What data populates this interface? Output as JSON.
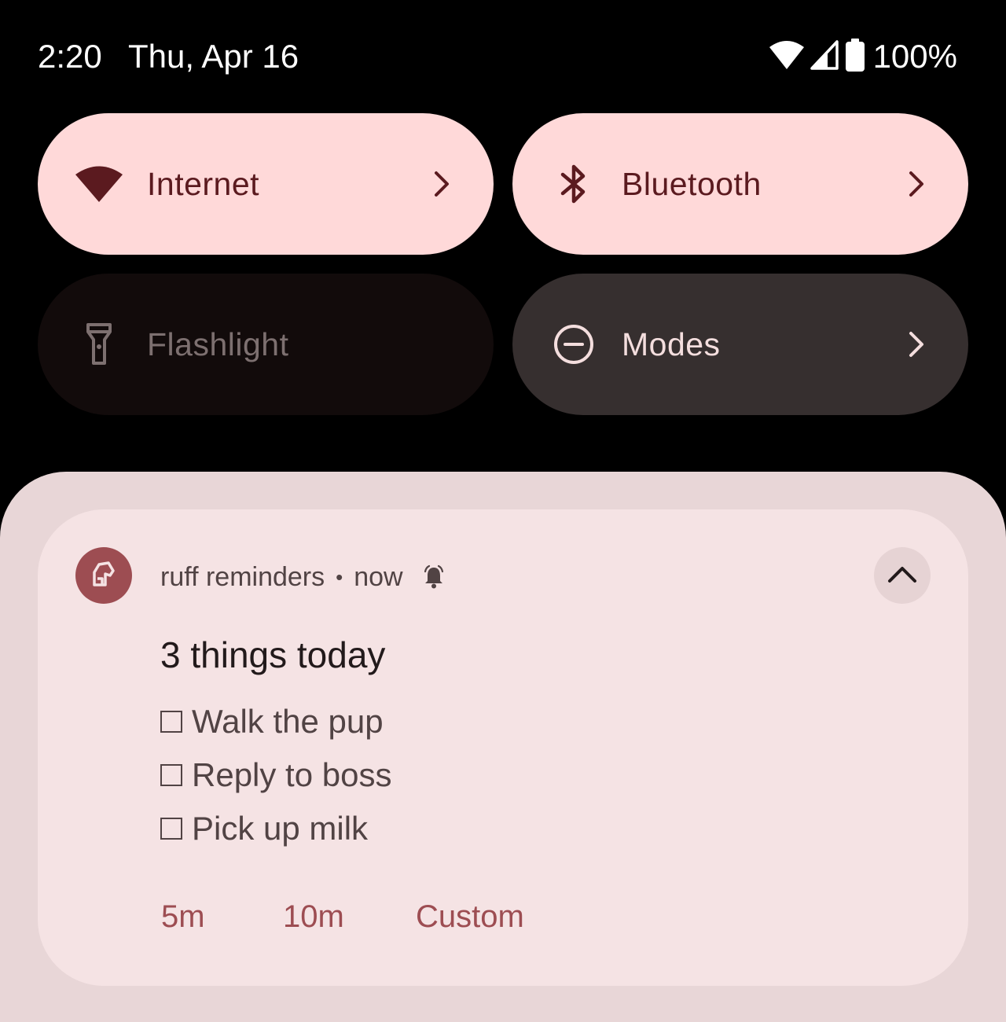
{
  "status_bar": {
    "time": "2:20",
    "date": "Thu, Apr 16",
    "battery_level": "100%",
    "icons": [
      "wifi-icon",
      "cell-signal-icon",
      "battery-icon"
    ]
  },
  "quick_settings": {
    "tiles": [
      {
        "label": "Internet",
        "icon": "wifi-icon",
        "state": "on",
        "has_chevron": true
      },
      {
        "label": "Bluetooth",
        "icon": "bluetooth-icon",
        "state": "on",
        "has_chevron": true
      },
      {
        "label": "Flashlight",
        "icon": "flashlight-icon",
        "state": "unavailable",
        "has_chevron": false
      },
      {
        "label": "Modes",
        "icon": "do-not-disturb-icon",
        "state": "off",
        "has_chevron": true
      }
    ]
  },
  "notification": {
    "app_name": "ruff reminders",
    "separator": "•",
    "time": "now",
    "alert_icon": "alarm-bell-icon",
    "app_icon": "dog-icon",
    "expand_icon": "chevron-up-icon",
    "title": "3 things today",
    "tasks": [
      {
        "checkbox": "☐",
        "text": "Walk the pup"
      },
      {
        "checkbox": "☐",
        "text": "Reply to boss"
      },
      {
        "checkbox": "☐",
        "text": "Pick up milk"
      }
    ],
    "actions": [
      "5m",
      "10m",
      "Custom"
    ]
  },
  "colors": {
    "tile_on_bg": "#ffd9d9",
    "tile_on_fg": "#5b1a1f",
    "tile_off_bg": "#362f2f",
    "tile_unavailable_bg": "#120b0b",
    "shade_bg": "#e8d6d7",
    "card_bg": "#f5e3e4",
    "accent": "#9d4d52"
  }
}
